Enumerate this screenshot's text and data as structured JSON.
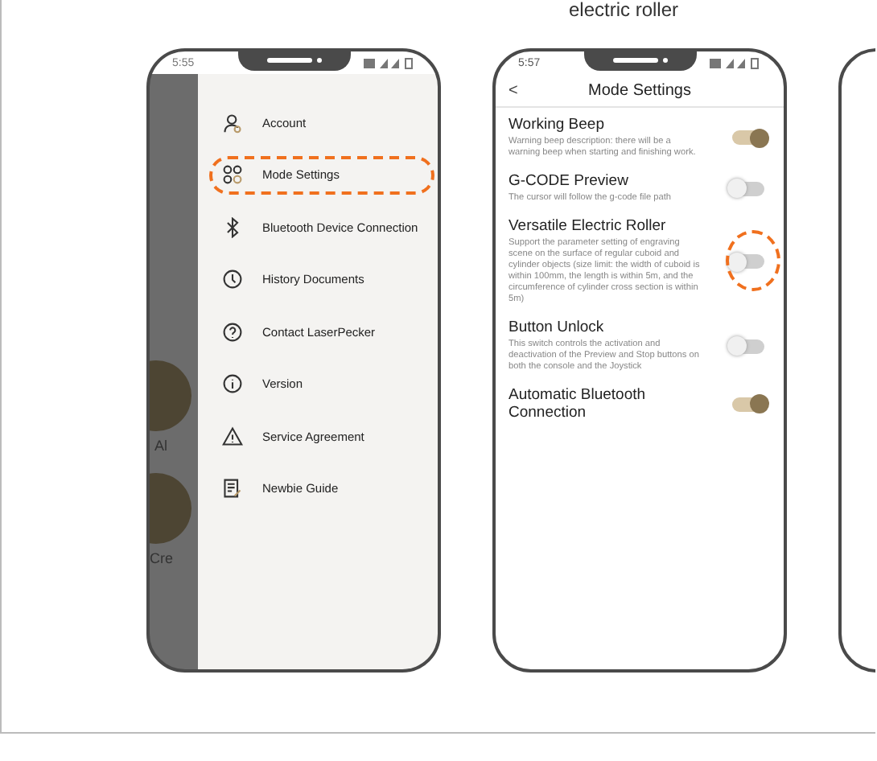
{
  "caption": "electric roller",
  "menu_phone": {
    "time": "5:55",
    "background_labels": [
      "Al",
      "Cre"
    ],
    "menu": [
      {
        "label": "Account",
        "kind": "account",
        "highlighted": false
      },
      {
        "label": "Mode Settings",
        "kind": "grid",
        "highlighted": true
      },
      {
        "label": "Bluetooth Device Connection",
        "kind": "bluetooth",
        "highlighted": false
      },
      {
        "label": "History Documents",
        "kind": "clock",
        "highlighted": false
      },
      {
        "label": "Contact LaserPecker",
        "kind": "help",
        "highlighted": false
      },
      {
        "label": "Version",
        "kind": "info",
        "highlighted": false
      },
      {
        "label": "Service Agreement",
        "kind": "warning",
        "highlighted": false
      },
      {
        "label": "Newbie Guide",
        "kind": "guide",
        "highlighted": false
      }
    ]
  },
  "settings_phone": {
    "time": "5:57",
    "back": "<",
    "title": "Mode Settings",
    "settings": [
      {
        "title": "Working Beep",
        "description": "Warning beep description: there will be a warning beep when starting and finishing work.",
        "on": true,
        "highlighted": false
      },
      {
        "title": "G-CODE Preview",
        "description": "The cursor will follow the g-code file path",
        "on": false,
        "highlighted": false
      },
      {
        "title": "Versatile Electric Roller",
        "description": "Support the parameter setting of engraving scene on the surface of regular cuboid and cylinder objects (size limit: the width of cuboid is within 100mm, the length is within 5m, and the circumference of cylinder cross section is within 5m)",
        "on": false,
        "highlighted": true
      },
      {
        "title": "Button Unlock",
        "description": "This switch controls the activation and deactivation of the Preview and Stop buttons on both the console and the Joystick",
        "on": false,
        "highlighted": false
      },
      {
        "title": "Automatic Bluetooth Connection",
        "on": true,
        "highlighted": false
      }
    ]
  }
}
